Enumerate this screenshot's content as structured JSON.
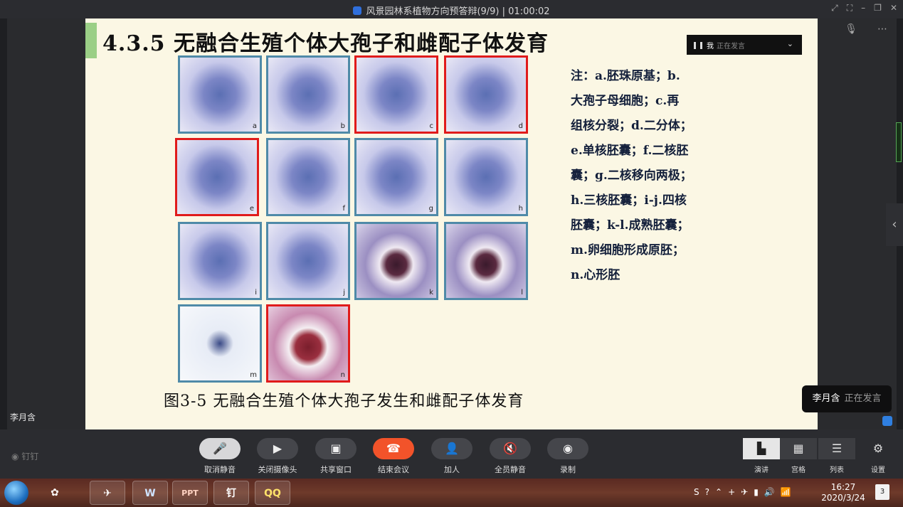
{
  "window": {
    "title": "风景园林系植物方向预答辩(9/9) | 01:00:02"
  },
  "slide": {
    "heading": "4.3.5 无融合生殖个体大孢子和雌配子体发育",
    "panels": [
      {
        "label": "a",
        "highlight": false
      },
      {
        "label": "b",
        "highlight": false
      },
      {
        "label": "c",
        "highlight": true
      },
      {
        "label": "d",
        "highlight": true
      },
      {
        "label": "e",
        "highlight": true
      },
      {
        "label": "f",
        "highlight": false
      },
      {
        "label": "g",
        "highlight": false
      },
      {
        "label": "h",
        "highlight": false
      },
      {
        "label": "i",
        "highlight": false
      },
      {
        "label": "j",
        "highlight": false
      },
      {
        "label": "k",
        "highlight": false
      },
      {
        "label": "l",
        "highlight": false
      },
      {
        "label": "m",
        "highlight": false
      },
      {
        "label": "n",
        "highlight": true
      }
    ],
    "notes": [
      "注：a.胚珠原基；b.",
      "大孢子母细胞；c.再",
      "组核分裂；d.二分体；",
      "e.单核胚囊；f.二核胚",
      "囊；g.二核移向两极；",
      "h.三核胚囊；i-j.四核",
      "胚囊；k-l.成熟胚囊；",
      "m.卵细胞形成原胚；",
      "n.心形胚"
    ],
    "caption": "图3-5 无融合生殖个体大孢子发生和雌配子体发育"
  },
  "speaking_indicator": {
    "name": "我",
    "status": "正在发言"
  },
  "speaker_name": "李月含",
  "speaker_toast": {
    "name": "李月含",
    "status": "正在发言"
  },
  "toolbar": {
    "app_name": "钉钉",
    "buttons": [
      {
        "label": "取消静音",
        "icon": "microphone-muted-icon"
      },
      {
        "label": "关闭摄像头",
        "icon": "camera-icon"
      },
      {
        "label": "共享窗口",
        "icon": "share-window-icon"
      },
      {
        "label": "结束会议",
        "icon": "hang-up-icon"
      },
      {
        "label": "加人",
        "icon": "add-person-icon"
      },
      {
        "label": "全员静音",
        "icon": "mute-all-icon"
      },
      {
        "label": "录制",
        "icon": "record-icon"
      }
    ],
    "views": [
      {
        "label": "演讲",
        "selected": true
      },
      {
        "label": "宫格",
        "selected": false
      },
      {
        "label": "列表",
        "selected": false
      }
    ],
    "settings_label": "设置"
  },
  "taskbar": {
    "apps": [
      "W",
      "PPT",
      "钉",
      "QQ"
    ],
    "time": "16:27",
    "date": "2020/3/24",
    "notifications": "3"
  },
  "colors": {
    "slide_bg": "#fbf7e4",
    "panel_border": "#4f8aa8",
    "panel_highlight": "#e01b1b",
    "end_call": "#f2532a",
    "accent_green": "#9bcf86"
  }
}
